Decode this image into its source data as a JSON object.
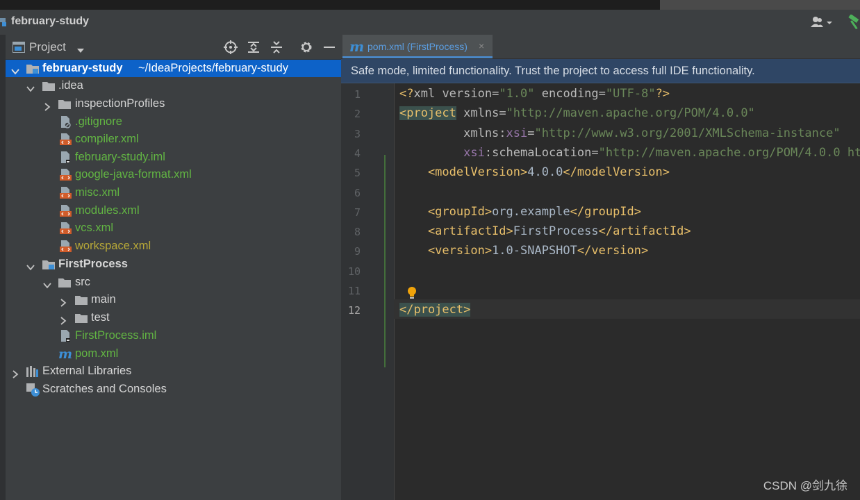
{
  "window": {
    "title": "february-study"
  },
  "project_panel": {
    "view_label": "Project",
    "tree": [
      {
        "label": "february-study",
        "path": "~/IdeaProjects/february-study",
        "level": 0,
        "expanded": true,
        "icon": "module-folder-icon"
      },
      {
        "label": ".idea",
        "level": 1,
        "expanded": true,
        "icon": "folder-icon"
      },
      {
        "label": "inspectionProfiles",
        "level": 2,
        "expanded": false,
        "icon": "folder-icon"
      },
      {
        "label": ".gitignore",
        "level": 2,
        "icon": "ignore-file-icon"
      },
      {
        "label": "compiler.xml",
        "level": 2,
        "icon": "xml-file-icon"
      },
      {
        "label": "february-study.iml",
        "level": 2,
        "icon": "iml-file-icon"
      },
      {
        "label": "google-java-format.xml",
        "level": 2,
        "icon": "xml-file-icon"
      },
      {
        "label": "misc.xml",
        "level": 2,
        "icon": "xml-file-icon"
      },
      {
        "label": "modules.xml",
        "level": 2,
        "icon": "xml-file-icon"
      },
      {
        "label": "vcs.xml",
        "level": 2,
        "icon": "xml-file-icon"
      },
      {
        "label": "workspace.xml",
        "level": 2,
        "icon": "xml-file-icon"
      },
      {
        "label": "FirstProcess",
        "level": 1,
        "expanded": true,
        "icon": "module-folder-icon"
      },
      {
        "label": "src",
        "level": 2,
        "expanded": true,
        "icon": "folder-icon"
      },
      {
        "label": "main",
        "level": 3,
        "expanded": false,
        "icon": "folder-icon"
      },
      {
        "label": "test",
        "level": 3,
        "expanded": false,
        "icon": "folder-icon"
      },
      {
        "label": "FirstProcess.iml",
        "level": 2,
        "icon": "iml-file-icon"
      },
      {
        "label": "pom.xml",
        "level": 2,
        "icon": "maven-icon"
      },
      {
        "label": "External Libraries",
        "level": 0,
        "expanded": false,
        "icon": "libraries-icon"
      },
      {
        "label": "Scratches and Consoles",
        "level": 0,
        "icon": "scratches-icon"
      }
    ]
  },
  "editor": {
    "tab": {
      "label": "pom.xml (FirstProcess)",
      "close": "×"
    },
    "banner": "Safe mode, limited functionality. Trust the project to access full IDE functionality.",
    "current_line": 12,
    "line_numbers": [
      "1",
      "2",
      "3",
      "4",
      "5",
      "6",
      "7",
      "8",
      "9",
      "10",
      "11",
      "12"
    ],
    "lines": [
      [
        {
          "t": "<?",
          "c": "tag"
        },
        {
          "t": "xml ",
          "c": "attr"
        },
        {
          "t": "version",
          "c": "attr"
        },
        {
          "t": "=",
          "c": "attr"
        },
        {
          "t": "\"1.0\"",
          "c": "str"
        },
        {
          "t": " encoding",
          "c": "attr"
        },
        {
          "t": "=",
          "c": "attr"
        },
        {
          "t": "\"UTF-8\"",
          "c": "str"
        },
        {
          "t": "?>",
          "c": "tag"
        }
      ],
      [
        {
          "t": "<project",
          "c": "tag-hl"
        },
        {
          "t": " xmlns",
          "c": "attr"
        },
        {
          "t": "=",
          "c": "attr"
        },
        {
          "t": "\"http://maven.apache.org/POM/4.0.0\"",
          "c": "str"
        }
      ],
      [
        {
          "t": "         xmlns:",
          "c": "attr"
        },
        {
          "t": "xsi",
          "c": "ns"
        },
        {
          "t": "=",
          "c": "attr"
        },
        {
          "t": "\"http://www.w3.org/2001/XMLSchema-instance\"",
          "c": "str"
        }
      ],
      [
        {
          "t": "         ",
          "c": "attr"
        },
        {
          "t": "xsi",
          "c": "ns"
        },
        {
          "t": ":schemaLocation",
          "c": "attr"
        },
        {
          "t": "=",
          "c": "attr"
        },
        {
          "t": "\"http://maven.apache.org/POM/4.0.0 ht",
          "c": "str"
        }
      ],
      [
        {
          "t": "    <modelVersion>",
          "c": "tag"
        },
        {
          "t": "4.0.0",
          "c": "txt"
        },
        {
          "t": "</modelVersion>",
          "c": "tag"
        }
      ],
      [],
      [
        {
          "t": "    <groupId>",
          "c": "tag"
        },
        {
          "t": "org.example",
          "c": "txt"
        },
        {
          "t": "</groupId>",
          "c": "tag"
        }
      ],
      [
        {
          "t": "    <artifactId>",
          "c": "tag"
        },
        {
          "t": "FirstProcess",
          "c": "txt"
        },
        {
          "t": "</artifactId>",
          "c": "tag"
        }
      ],
      [
        {
          "t": "    <version>",
          "c": "tag"
        },
        {
          "t": "1.0-SNAPSHOT",
          "c": "txt"
        },
        {
          "t": "</version>",
          "c": "tag"
        }
      ],
      [],
      [],
      [
        {
          "t": "</project>",
          "c": "tag-hl"
        }
      ]
    ]
  },
  "watermark": "CSDN @剑九徐"
}
